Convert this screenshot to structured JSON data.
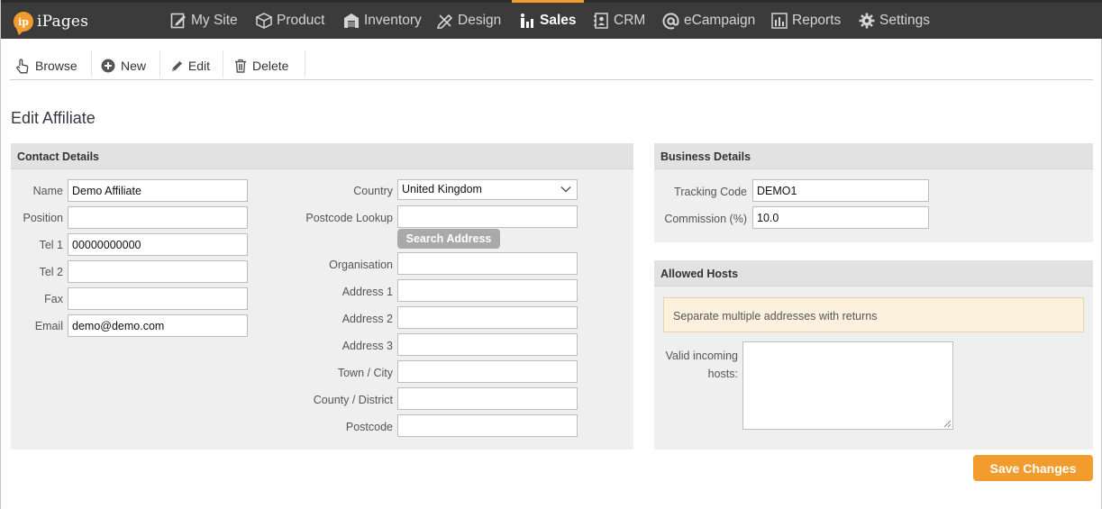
{
  "app": {
    "logo_badge": "ip",
    "logo_text": "iPages"
  },
  "nav": {
    "items": [
      {
        "label": "My Site",
        "icon": "my-site-icon"
      },
      {
        "label": "Product",
        "icon": "product-box-icon"
      },
      {
        "label": "Inventory",
        "icon": "warehouse-icon"
      },
      {
        "label": "Design",
        "icon": "design-tools-icon"
      },
      {
        "label": "Sales",
        "icon": "sales-chart-icon",
        "active": true
      },
      {
        "label": "CRM",
        "icon": "address-book-icon"
      },
      {
        "label": "eCampaign",
        "icon": "at-sign-icon"
      },
      {
        "label": "Reports",
        "icon": "bar-chart-icon"
      },
      {
        "label": "Settings",
        "icon": "gear-icon"
      }
    ]
  },
  "toolbar": {
    "browse": "Browse",
    "new": "New",
    "edit": "Edit",
    "delete": "Delete"
  },
  "page": {
    "title": "Edit Affiliate"
  },
  "contact": {
    "heading": "Contact Details",
    "name_label": "Name",
    "name_value": "Demo Affiliate",
    "position_label": "Position",
    "position_value": "",
    "tel1_label": "Tel 1",
    "tel1_value": "00000000000",
    "tel2_label": "Tel 2",
    "tel2_value": "",
    "fax_label": "Fax",
    "fax_value": "",
    "email_label": "Email",
    "email_value": "demo@demo.com",
    "country_label": "Country",
    "country_value": "United Kingdom",
    "postcode_lookup_label": "Postcode Lookup",
    "postcode_lookup_value": "",
    "search_address_button": "Search Address",
    "organisation_label": "Organisation",
    "organisation_value": "",
    "address1_label": "Address 1",
    "address1_value": "",
    "address2_label": "Address 2",
    "address2_value": "",
    "address3_label": "Address 3",
    "address3_value": "",
    "town_label": "Town / City",
    "town_value": "",
    "county_label": "County / District",
    "county_value": "",
    "postcode_label": "Postcode",
    "postcode_value": ""
  },
  "business": {
    "heading": "Business Details",
    "tracking_label": "Tracking Code",
    "tracking_value": "DEMO1",
    "commission_label": "Commission (%)",
    "commission_value": "10.0"
  },
  "hosts": {
    "heading": "Allowed Hosts",
    "note": "Separate multiple addresses with returns",
    "label_line1": "Valid incoming",
    "label_line2": "hosts:",
    "value": ""
  },
  "actions": {
    "save": "Save Changes"
  },
  "colors": {
    "accent": "#f39c2e",
    "nav_bg": "#3b3b3b",
    "panel_bg": "#efefef",
    "panel_head_bg": "#e2e2e2",
    "note_bg": "#fcf1dc"
  }
}
